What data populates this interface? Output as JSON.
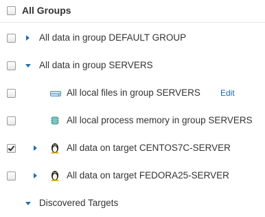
{
  "header": {
    "label": "All Groups"
  },
  "rows": [
    {
      "label": "All data in group DEFAULT GROUP",
      "checked": false,
      "expand": "collapsed",
      "icon": "none"
    },
    {
      "label": "All data in group SERVERS",
      "checked": false,
      "expand": "expanded",
      "icon": "none"
    },
    {
      "label": "All local files in group SERVERS",
      "checked": false,
      "expand": "none",
      "icon": "drive-icon",
      "action": "Edit"
    },
    {
      "label": "All local process memory in group SERVERS",
      "checked": false,
      "expand": "none",
      "icon": "memory-chip-icon"
    },
    {
      "label": "All data on target CENTOS7C-SERVER",
      "checked": true,
      "expand": "collapsed",
      "icon": "linux-penguin-icon"
    },
    {
      "label": "All data on target FEDORA25-SERVER",
      "checked": false,
      "expand": "collapsed",
      "icon": "linux-penguin-icon"
    },
    {
      "label": "Discovered Targets",
      "checked": false,
      "expand": "expanded",
      "icon": "none"
    }
  ],
  "colors": {
    "accent": "#1f6fae",
    "link": "#1a66b3",
    "text": "#333333"
  }
}
